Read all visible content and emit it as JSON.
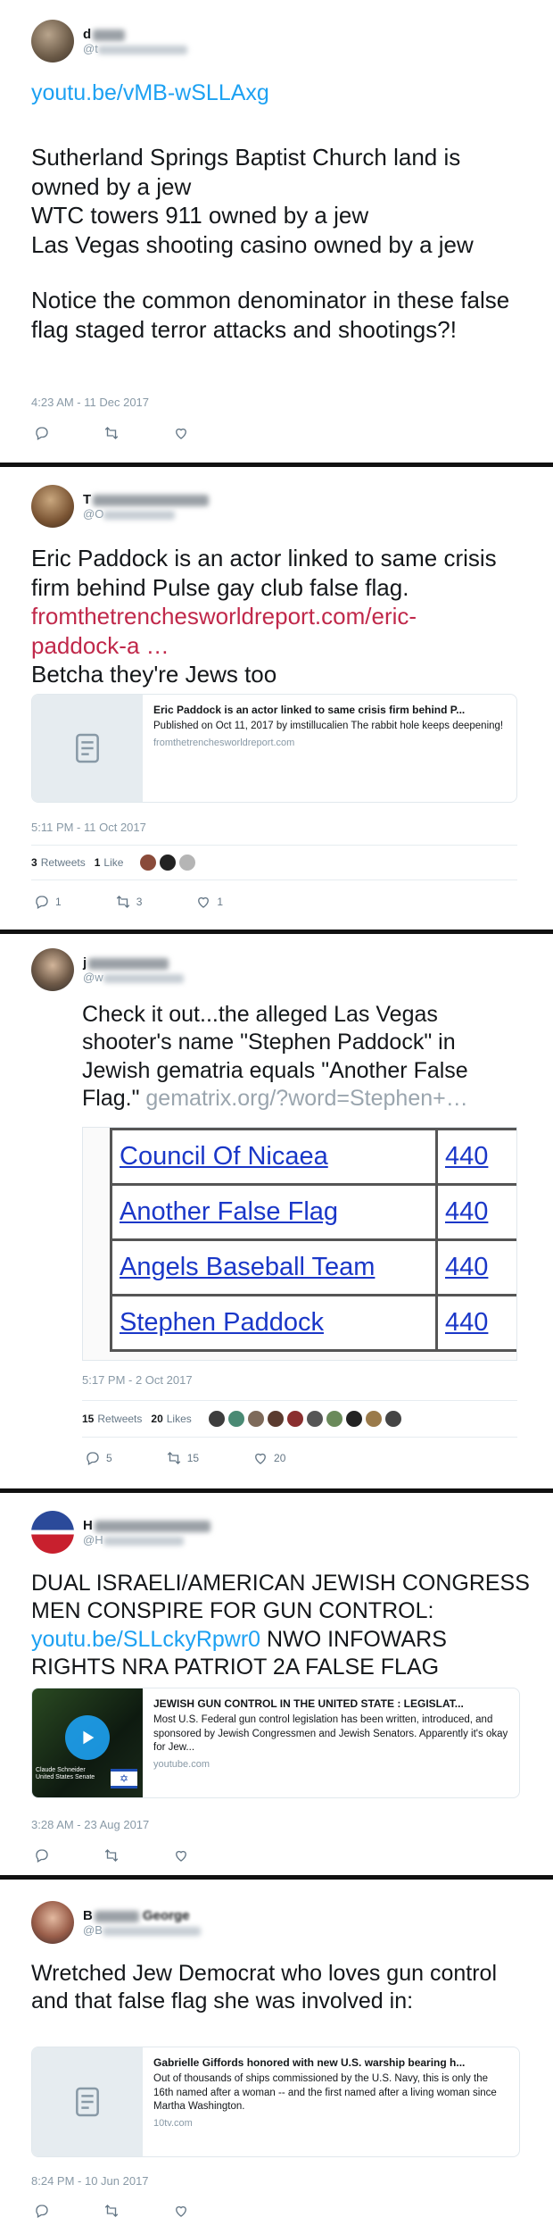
{
  "icons": {
    "reply": "reply-icon",
    "retweet": "retweet-icon",
    "like": "heart-icon",
    "card": "document-icon"
  },
  "tweets": [
    {
      "display_name": "d",
      "handle": "@t",
      "link": "youtu.be/vMB-wSLLAxg",
      "lines": [
        "Sutherland Springs Baptist Church land is owned by a jew",
        "WTC towers 911 owned by a jew",
        "Las Vegas shooting casino owned by a jew",
        "Notice the common denominator in these false flag staged terror attacks and shootings?!"
      ],
      "timestamp": "4:23 AM - 11 Dec 2017"
    },
    {
      "display_name": "T",
      "handle": "@O",
      "text": "Eric Paddock is an actor linked to same crisis firm behind Pulse gay club false flag.",
      "link": "fromthetrencheswor ldreport.com/eric-paddock-a …",
      "link_line1": "fromthetrenchesworldreport.com/eric-",
      "link_line2": "paddock-a  …",
      "text2": "Betcha they're Jews too",
      "card": {
        "title": "Eric Paddock is an actor linked to same crisis firm behind P...",
        "desc": "Published on Oct 11, 2017 by imstillucalien The rabbit hole keeps deepening!",
        "domain": "fromthetrenchesworldreport.com"
      },
      "timestamp": "5:11 PM - 11 Oct 2017",
      "retweets": "3",
      "retweets_label": "Retweets",
      "likes": "1",
      "likes_label": "Like",
      "reply_count": "1",
      "retweet_count": "3",
      "like_count": "1"
    },
    {
      "display_name": "j",
      "handle": "@w",
      "text": "Check it out...the alleged Las Vegas shooter's name \"Stephen Paddock\" in Jewish gematria equals \"Another False Flag.\"",
      "link": "gematrix.org/?word=Stephen+…",
      "table": [
        {
          "phrase": "Council Of Nicaea",
          "value": "440"
        },
        {
          "phrase": "Another False Flag",
          "value": "440"
        },
        {
          "phrase": "Angels Baseball Team",
          "value": "440"
        },
        {
          "phrase": "Stephen Paddock",
          "value": "440"
        }
      ],
      "timestamp": "5:17 PM - 2 Oct 2017",
      "retweets": "15",
      "retweets_label": "Retweets",
      "likes": "20",
      "likes_label": "Likes",
      "reply_count": "5",
      "retweet_count": "15",
      "like_count": "20"
    },
    {
      "display_name": "H",
      "handle": "@H",
      "text": "DUAL ISRAELI/AMERICAN JEWISH CONGRESS MEN CONSPIRE FOR GUN CONTROL:",
      "link": "youtu.be/SLLckyRpwr0",
      "text2": "NWO INFOWARS RIGHTS NRA PATRIOT 2A FALSE FLAG",
      "card": {
        "title": "JEWISH GUN CONTROL IN THE UNITED STATE : LEGISLAT...",
        "desc": "Most U.S. Federal gun control legislation has been written, introduced, and sponsored by Jewish Congressmen and Jewish Senators. Apparently it's okay for Jew...",
        "domain": "youtube.com",
        "thumb_caption": "Claude Schneider United States Senate"
      },
      "timestamp": "3:28 AM - 23 Aug 2017"
    },
    {
      "display_name": "B",
      "name_suffix": "George",
      "handle": "@B",
      "text": "Wretched Jew Democrat who loves gun control and that false flag she was involved in:",
      "card": {
        "title": "Gabrielle Giffords honored with new U.S. warship bearing h...",
        "desc": "Out of thousands of ships commissioned by the U.S. Navy, this is only the 16th named after a woman -- and the first named after a living woman since Martha Washington.",
        "domain": "10tv.com"
      },
      "timestamp": "8:24 PM - 10 Jun 2017"
    }
  ]
}
